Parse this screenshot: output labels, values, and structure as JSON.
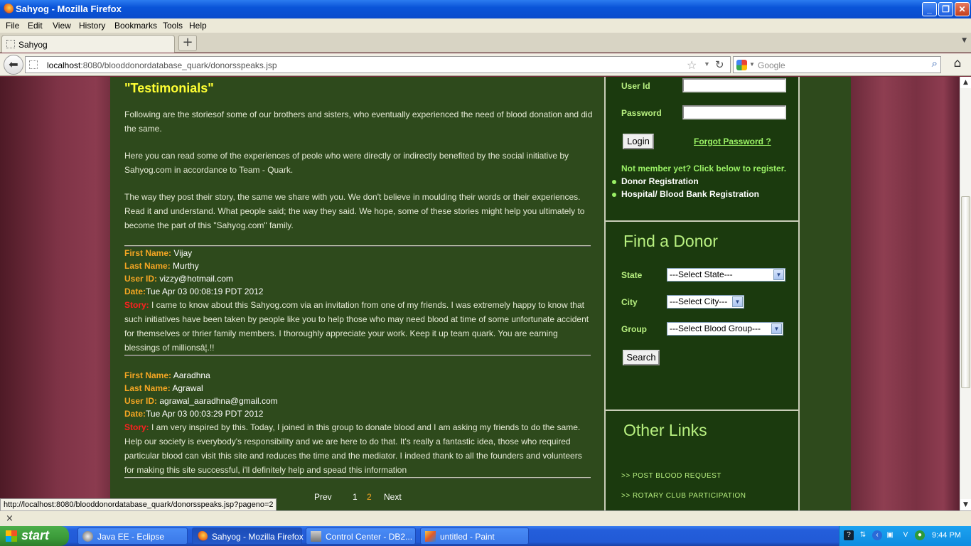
{
  "window": {
    "title": "Sahyog - Mozilla Firefox"
  },
  "menu": [
    "File",
    "Edit",
    "View",
    "History",
    "Bookmarks",
    "Tools",
    "Help"
  ],
  "tab": {
    "label": "Sahyog",
    "new_tab": "+"
  },
  "nav": {
    "url_host": "localhost",
    "url_rest": ":8080/blooddonordatabase_quark/donorsspeaks.jsp",
    "search_placeholder": "Google"
  },
  "page": {
    "heading": "\"Testimonials\"",
    "intro": [
      "Following are the storiesof some of our brothers and sisters, who eventually experienced the need of blood donation and did the same.",
      "Here you can read some of the experiences of peole who were directly or indirectly benefited by the social initiative by Sahyog.com in accordance to Team - Quark.",
      "The way they post their story, the same we share with you. We don't believe in moulding their words or their experiences. Read it and understand. What people said; the way they said. We hope, some of these stories might help you ultimately to become the part of this \"Sahyog.com\" family."
    ],
    "labels": {
      "first_name": "First Name:",
      "last_name": "Last Name:",
      "user_id": "User ID:",
      "date": "Date:",
      "story": "Story:"
    },
    "records": [
      {
        "first_name": "Vijay",
        "last_name": "Murthy",
        "user_id": "vizzy@hotmail.com",
        "date": "Tue Apr 03 00:08:19 PDT 2012",
        "story": "I came to know about this Sahyog.com via an invitation from one of my friends. I was extremely happy to know that such initiatives have been taken by people like you to help those who may need blood at time of some unfortunate accident for themselves or thrier family members. I thoroughly appreciate your work. Keep it up team quark. You are earning blessings of millionsâ¦.!!"
      },
      {
        "first_name": "Aaradhna",
        "last_name": "Agrawal",
        "user_id": "agrawal_aaradhna@gmail.com",
        "date": "Tue Apr 03 00:03:29 PDT 2012",
        "story": "I am very inspired by this. Today, I joined in this group to donate blood and I am asking my friends to do the same. Help our society is everybody's responsibility and we are here to do that. It's really a fantastic idea, those who required particular blood can visit this site and reduces the time and the mediator. I indeed thank to all the founders and volunteers for making this site successful, i'll definitely help and spead this information"
      }
    ],
    "pager": {
      "prev": "Prev",
      "p1": "1",
      "p2": "2",
      "next": "Next",
      "current": "2"
    }
  },
  "sidebar": {
    "login": {
      "userid_label": "User Id",
      "password_label": "Password",
      "login_button": "Login",
      "forgot": "Forgot Password ?",
      "not_member": "Not member yet? Click below to register.",
      "donor_reg": "Donor Registration",
      "hospital_reg": "Hospital/ Blood Bank Registration"
    },
    "find": {
      "heading": "Find a Donor",
      "state_label": "State",
      "state_value": "---Select State---",
      "city_label": "City",
      "city_value": "---Select City---",
      "group_label": "Group",
      "group_value": "---Select Blood Group---",
      "search_button": "Search"
    },
    "other": {
      "heading": "Other Links",
      "links": [
        ">>  POST BLOOD REQUEST",
        ">>  ROTARY CLUB PARTICIPATION"
      ]
    }
  },
  "status": {
    "link_url": "http://localhost:8080/blooddonordatabase_quark/donorsspeaks.jsp?pageno=2",
    "addon_close": "×"
  },
  "taskbar": {
    "start": "start",
    "tasks": [
      "Java EE - Eclipse",
      "Sahyog - Mozilla Firefox",
      "Control Center - DB2...",
      "untitled - Paint"
    ],
    "clock": "9:44 PM"
  }
}
